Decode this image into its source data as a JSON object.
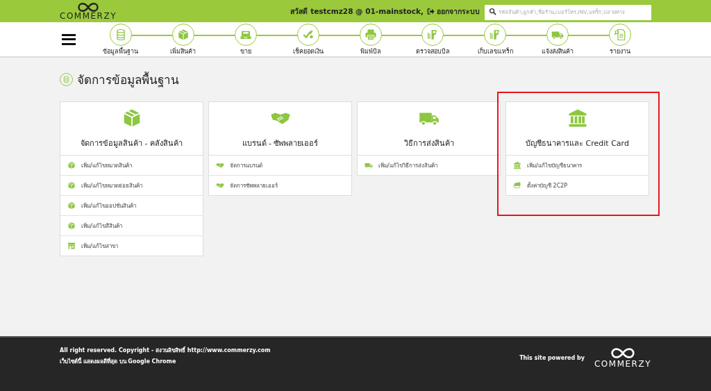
{
  "header": {
    "logo": "COMMERZY",
    "greeting": "สวัสดี testcmz28 @ 01-mainstock,",
    "logout": "ออกจากระบบ",
    "search": {
      "placeholder": "รหัสสินค้า,ลูกค้า,ชื่อร้าน,เบอร์โทร,INV,แทร็ก,ปลายทาง"
    }
  },
  "nav": {
    "steps": [
      {
        "label": "ข้อมูลพื้นฐาน",
        "kind": "database"
      },
      {
        "label": "เพิ่มสินค้า",
        "kind": "box"
      },
      {
        "label": "ขาย",
        "kind": "register"
      },
      {
        "label": "เช็คยอดเงิน",
        "kind": "check"
      },
      {
        "label": "พิมพ์บิล",
        "kind": "printer"
      },
      {
        "label": "ตรวจสอบบิล",
        "kind": "scanner"
      },
      {
        "label": "เก็บเลขแทร็ก",
        "kind": "scanner"
      },
      {
        "label": "แจ้งส่งสินค้า",
        "kind": "truck"
      },
      {
        "label": "รายงาน",
        "kind": "report"
      }
    ]
  },
  "page": {
    "title": "จัดการข้อมูลพื้นฐาน"
  },
  "cards": [
    {
      "title": "จัดการข้อมูลสินค้า - คลังสินค้า",
      "kind": "box",
      "highlighted": false,
      "items": [
        {
          "label": "เพิ่ม/แก้ไขหมวดสินค้า",
          "kind": "box"
        },
        {
          "label": "เพิ่ม/แก้ไขหมวดย่อยสินค้า",
          "kind": "box"
        },
        {
          "label": "เพิ่ม/แก้ไขออปชั่นสินค้า",
          "kind": "box"
        },
        {
          "label": "เพิ่ม/แก้ไขสีสินค้า",
          "kind": "box"
        },
        {
          "label": "เพิ่ม/แก้ไขสาขา",
          "kind": "store"
        }
      ]
    },
    {
      "title": "แบรนด์ - ซัพพลายเออร์",
      "kind": "handshake",
      "highlighted": false,
      "items": [
        {
          "label": "จัดการแบรนด์",
          "kind": "handshake"
        },
        {
          "label": "จัดการซัพพลายเออร์",
          "kind": "handshake"
        }
      ]
    },
    {
      "title": "วิธีการส่งสินค้า",
      "kind": "truck",
      "highlighted": false,
      "items": [
        {
          "label": "เพิ่ม/แก้ไขวิธีการส่งสินค้า",
          "kind": "truck"
        }
      ]
    },
    {
      "title": "บัญชีธนาคารและ Credit Card",
      "kind": "bank",
      "highlighted": true,
      "items": [
        {
          "label": "เพิ่ม/แก้ไขบัญชีธนาคาร",
          "kind": "bank"
        },
        {
          "label": "ตั้งค่าบัญชี 2C2P",
          "kind": "cards"
        }
      ]
    }
  ],
  "footer": {
    "copyright": "All right reserved. Copyright - สงวนลิขสิทธิ์ http://www.commerzy.com",
    "browser_note": "เว็บไซต์นี้ แสดงผลดีที่สุด บน Google Chrome",
    "powered_by": "This site powered by",
    "logo": "COMMERZY"
  }
}
